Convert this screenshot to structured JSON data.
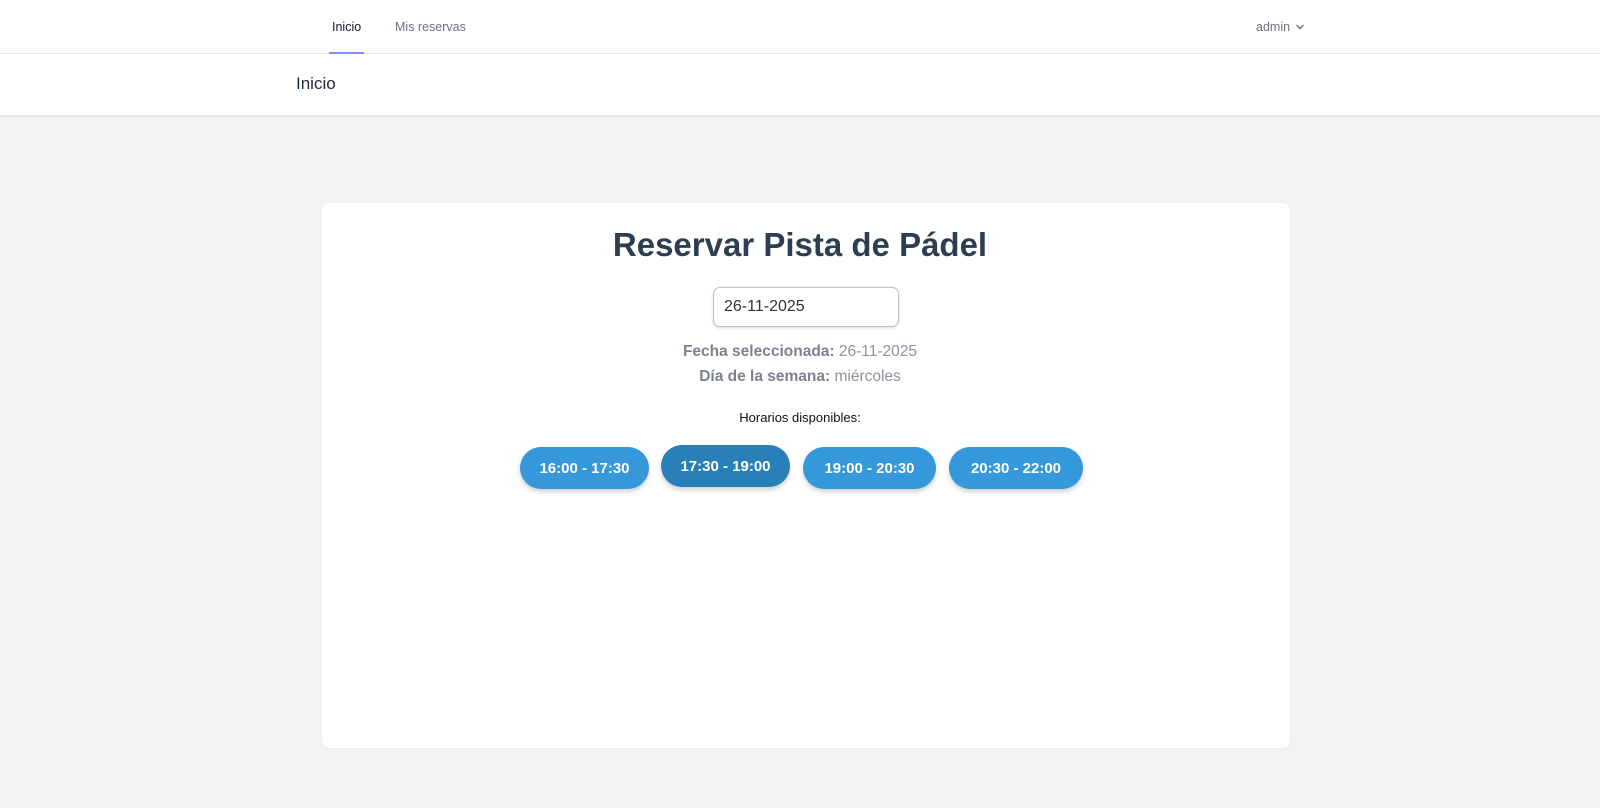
{
  "nav": {
    "items": [
      {
        "label": "Inicio",
        "active": true
      },
      {
        "label": "Mis reservas",
        "active": false
      }
    ],
    "user": {
      "name": "admin",
      "icon": "chevron-down-icon"
    }
  },
  "header": {
    "title": "Inicio"
  },
  "booking": {
    "title": "Reservar Pista de Pádel",
    "date_value": "26-11-2025",
    "selected_date_label": "Fecha seleccionada:",
    "selected_date_value": "26-11-2025",
    "weekday_label": "Día de la semana:",
    "weekday_value": "miércoles",
    "slots_label": "Horarios disponibles:",
    "slots": [
      {
        "label": "16:00 - 17:30"
      },
      {
        "label": "17:30 - 19:00"
      },
      {
        "label": "19:00 - 20:30"
      },
      {
        "label": "20:30 - 22:00"
      }
    ]
  },
  "colors": {
    "slot_bg": "#3498db",
    "slot_active_bg": "#2980b9",
    "nav_indicator": "#818cf8",
    "title_color": "#2c3e50"
  }
}
